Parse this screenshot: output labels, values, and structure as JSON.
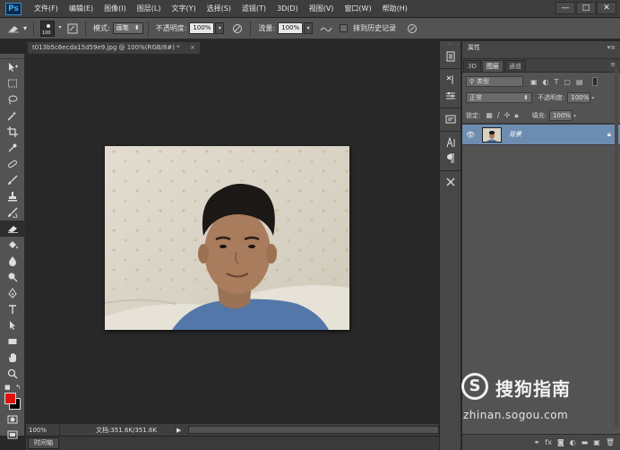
{
  "app": {
    "logo": "Ps"
  },
  "menu": [
    "文件(F)",
    "编辑(E)",
    "图像(I)",
    "图层(L)",
    "文字(Y)",
    "选择(S)",
    "滤镜(T)",
    "3D(D)",
    "视图(V)",
    "窗口(W)",
    "帮助(H)"
  ],
  "window_controls": {
    "minimize": "—",
    "restore": "□",
    "close": "✕"
  },
  "options": {
    "brush_size": "100",
    "mode_label": "模式:",
    "mode_value": "画笔",
    "opacity_label": "不透明度:",
    "opacity_value": "100%",
    "flow_label": "流量:",
    "flow_value": "100%",
    "erase_history_label": "抹到历史记录"
  },
  "document": {
    "tab_title": "t013b5c6ecda15d59e9.jpg @ 100%(RGB/8#) *",
    "close": "×",
    "zoom": "100%",
    "doc_info": "文档:351.6K/351.6K"
  },
  "timeline": {
    "label": "时间轴"
  },
  "panel": {
    "header_title": "属性",
    "tabs": [
      "3D",
      "图层",
      "通道"
    ],
    "filter_kind": "类型",
    "blend_mode": "正常",
    "opacity_label": "不透明度:",
    "opacity_value": "100%",
    "lock_label": "锁定:",
    "fill_label": "填充:",
    "fill_value": "100%",
    "layer_name": "背景"
  },
  "watermark": {
    "logo": "S",
    "brand": "搜狗指南",
    "url": "zhinan.sogou.com"
  },
  "colors": {
    "foreground": "#e01010",
    "background": "#000000",
    "layer_selected": "#6d8db0"
  }
}
